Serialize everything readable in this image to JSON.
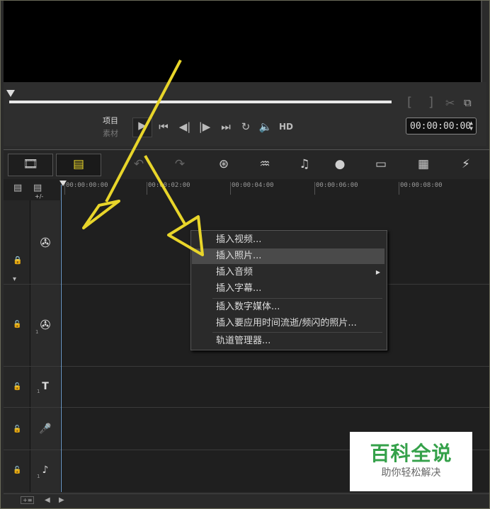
{
  "preview": {
    "mode_project": "项目",
    "mode_clip": "素材",
    "hd_label": "HD",
    "timecode": "00:00:00:00",
    "bracket_in": "[",
    "bracket_out": "]"
  },
  "toolbar": {
    "tools": [
      {
        "name": "storyboard-view-icon"
      },
      {
        "name": "timeline-view-icon"
      },
      {
        "name": "undo-icon"
      },
      {
        "name": "redo-icon"
      },
      {
        "name": "record-capture-icon"
      },
      {
        "name": "sound-mixer-icon"
      },
      {
        "name": "auto-music-icon"
      },
      {
        "name": "motion-track-icon"
      },
      {
        "name": "subtitle-editor-icon"
      },
      {
        "name": "multi-camera-icon"
      },
      {
        "name": "track-motion-icon"
      }
    ]
  },
  "ruler": {
    "ticks": [
      "00:00:00:00",
      "00:00:02:00",
      "00:00:04:00",
      "00:00:06:00",
      "00:00:08:00"
    ],
    "zoom_label": "+/-"
  },
  "context_menu": {
    "items": [
      {
        "label": "插入视频..."
      },
      {
        "label": "插入照片..."
      },
      {
        "label": "插入音频"
      },
      {
        "label": "插入字幕..."
      },
      {
        "label": "插入数字媒体..."
      },
      {
        "label": "插入要应用时间流逝/频闪的照片..."
      },
      {
        "label": "轨道管理器..."
      }
    ]
  },
  "tracks": [
    {
      "name": "video-track",
      "number": ""
    },
    {
      "name": "overlay-track",
      "number": "1"
    },
    {
      "name": "title-track",
      "number": "1"
    },
    {
      "name": "voice-track",
      "number": ""
    },
    {
      "name": "music-track",
      "number": "1"
    }
  ],
  "watermark": {
    "title": "百科全说",
    "subtitle": "助你轻松解决"
  },
  "colors": {
    "accent_yellow": "#e8d52a",
    "watermark_green": "#35a14a",
    "playhead": "#6f9fd0"
  }
}
